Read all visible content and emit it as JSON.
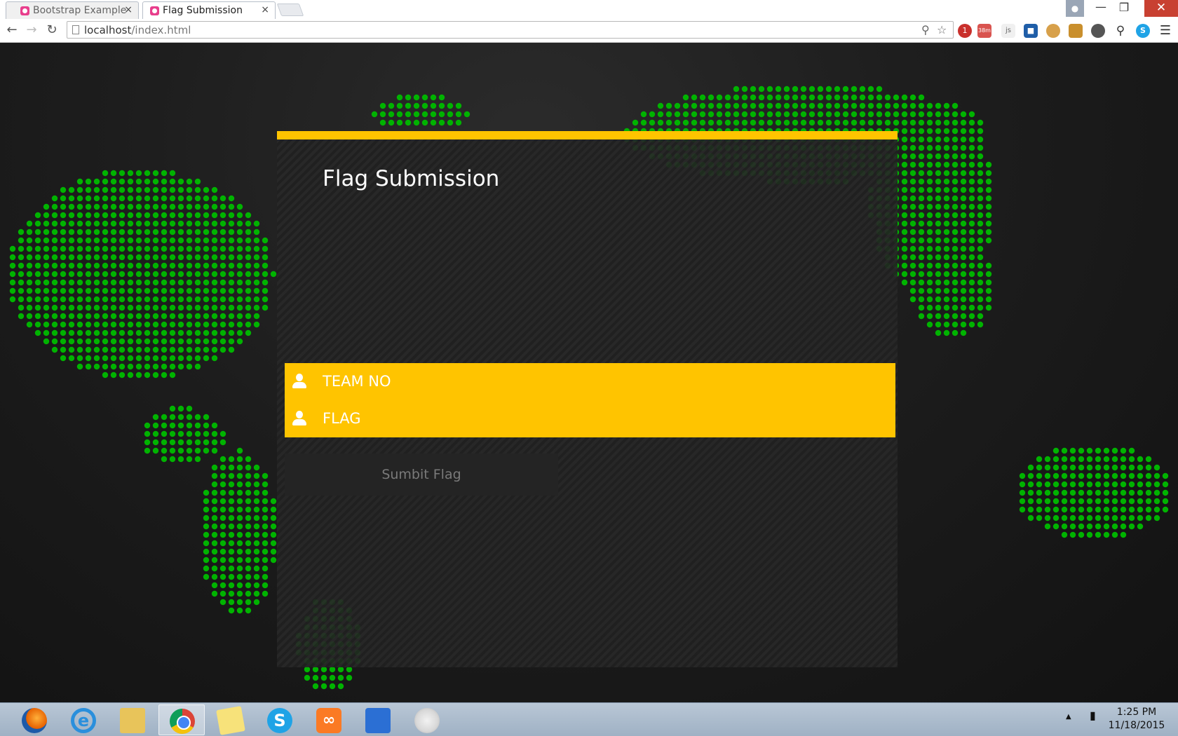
{
  "browser": {
    "tabs": [
      {
        "label": "Bootstrap Example",
        "close": "×"
      },
      {
        "label": "Flag Submission",
        "close": "×"
      }
    ],
    "window_controls": {
      "minimize": "—",
      "maximize": "❐",
      "close": "✕"
    },
    "url_host": "localhost",
    "url_path": "/index.html",
    "extensions": {
      "ext1_badge": "1",
      "ext2_badge": "38m",
      "ext3": "js"
    }
  },
  "page": {
    "title": "Flag Submission",
    "team_placeholder": "TEAM NO",
    "flag_placeholder": "FLAG",
    "submit_label": "Sumbit Flag",
    "accent_color": "#ffc400",
    "dot_color": "#00b300"
  },
  "taskbar": {
    "apps": [
      "firefox",
      "internet-explorer",
      "file-explorer",
      "chrome",
      "sticky-notes",
      "skype",
      "xampp",
      "app-blue",
      "paint"
    ],
    "clock_time": "1:25 PM",
    "clock_date": "11/18/2015"
  }
}
